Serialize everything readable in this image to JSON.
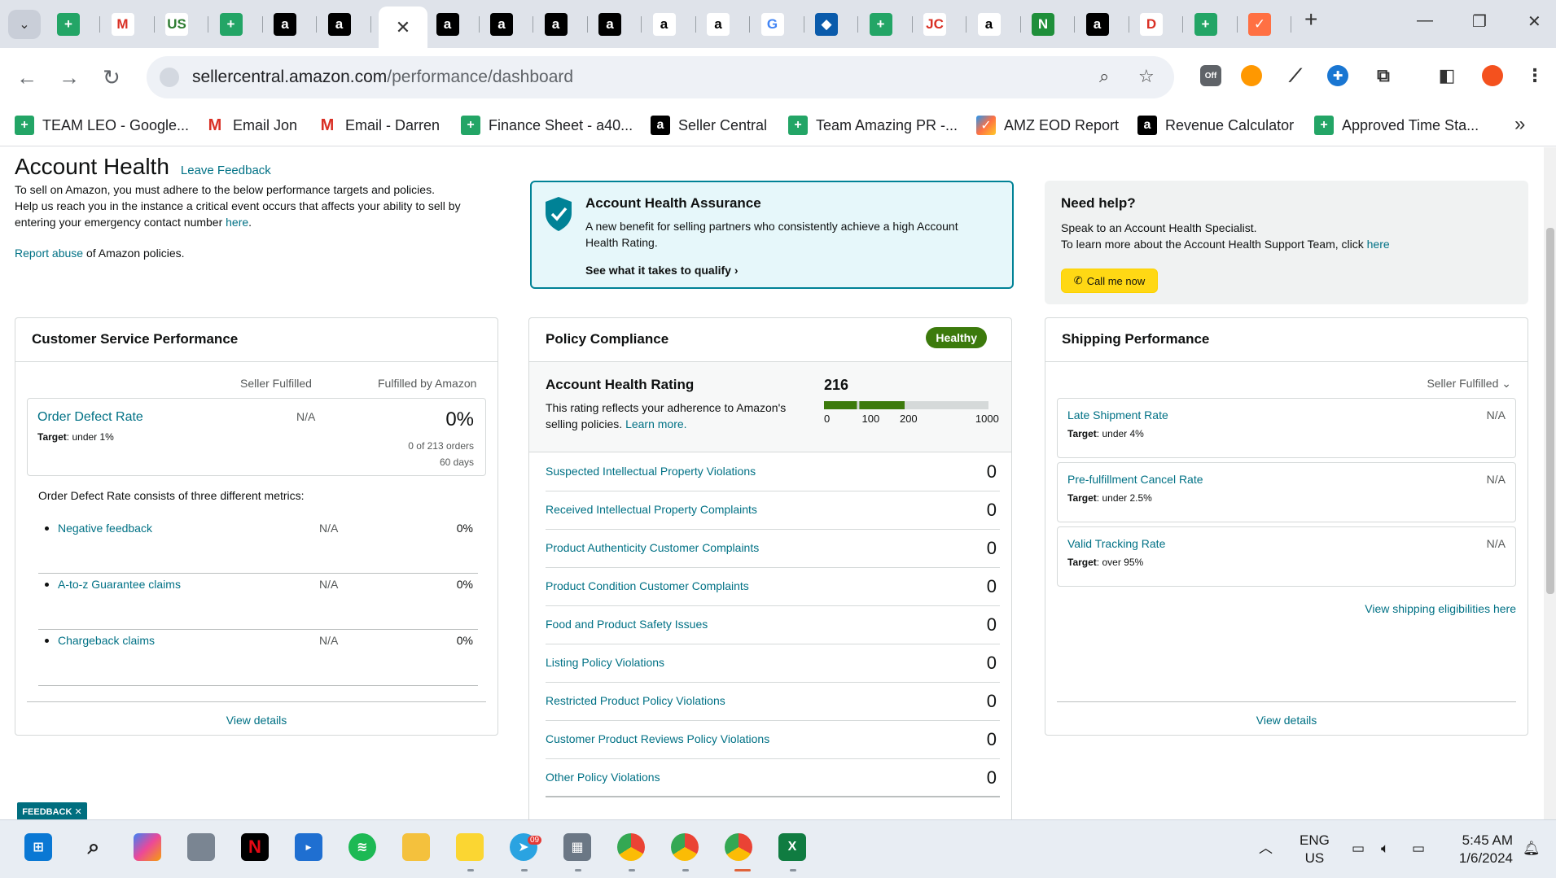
{
  "browser": {
    "url_host": "sellercentral.amazon.com",
    "url_path": "/performance/dashboard",
    "tab_close_glyph": "✕",
    "new_tab_glyph": "+",
    "extension_off_badge": "Off"
  },
  "bookmarks": [
    {
      "label": "TEAM LEO - Google...",
      "icon": "sheets-icon"
    },
    {
      "label": "Email Jon",
      "icon": "gmail-icon"
    },
    {
      "label": "Email - Darren",
      "icon": "gmail-icon"
    },
    {
      "label": "Finance Sheet - a40...",
      "icon": "sheets-icon"
    },
    {
      "label": "Seller Central",
      "icon": "amazon-icon"
    },
    {
      "label": "Team Amazing PR -...",
      "icon": "sheets-icon"
    },
    {
      "label": "AMZ EOD Report",
      "icon": "tasks-icon"
    },
    {
      "label": "Revenue Calculator",
      "icon": "amazon-icon"
    },
    {
      "label": "Approved Time Sta...",
      "icon": "sheets-icon"
    }
  ],
  "header": {
    "title": "Account Health",
    "leave_feedback": "Leave Feedback",
    "intro_1": "To sell on Amazon, you must adhere to the below performance targets and policies.",
    "intro_2": "Help us reach you in the instance a critical event occurs that affects your ability to sell by entering your emergency contact number ",
    "intro_link": "here",
    "intro_end": ".",
    "report_link": "Report abuse",
    "report_rest": " of Amazon policies."
  },
  "assurance": {
    "title": "Account Health Assurance",
    "desc": "A new benefit for selling partners who consistently achieve a high Account Health Rating.",
    "link": "See what it takes to qualify",
    "accent": "#008296"
  },
  "help": {
    "title": "Need help?",
    "line1": "Speak to an Account Health Specialist.",
    "line2": "To learn more about the Account Health Support Team, click ",
    "line2_link": "here",
    "call_button": "Call me now"
  },
  "customer_service": {
    "title": "Customer Service Performance",
    "col_seller": "Seller Fulfilled",
    "col_amazon": "Fulfilled by Amazon",
    "odr_name": "Order Defect Rate",
    "odr_target_label": "Target",
    "odr_target": ": under 1%",
    "odr_seller": "N/A",
    "odr_amazon": "0%",
    "odr_orders": "0 of 213 orders",
    "odr_period": "60 days",
    "note": "Order Defect Rate consists of three different metrics:",
    "metrics": [
      {
        "name": "Negative feedback",
        "seller": "N/A",
        "amazon": "0%"
      },
      {
        "name": "A-to-z Guarantee claims",
        "seller": "N/A",
        "amazon": "0%"
      },
      {
        "name": "Chargeback claims",
        "seller": "N/A",
        "amazon": "0%"
      }
    ],
    "view_details": "View details"
  },
  "policy": {
    "title": "Policy Compliance",
    "badge": "Healthy",
    "rating_title": "Account Health Rating",
    "rating_desc": "This rating reflects your adherence to Amazon's selling policies. ",
    "rating_link": "Learn more.",
    "score": "216",
    "score_fraction": 0.216,
    "ticks": [
      "0",
      "100",
      "200",
      "1000"
    ],
    "rows": [
      {
        "name": "Suspected Intellectual Property Violations",
        "value": "0"
      },
      {
        "name": "Received Intellectual Property Complaints",
        "value": "0"
      },
      {
        "name": "Product Authenticity Customer Complaints",
        "value": "0"
      },
      {
        "name": "Product Condition Customer Complaints",
        "value": "0"
      },
      {
        "name": "Food and Product Safety Issues",
        "value": "0"
      },
      {
        "name": "Listing Policy Violations",
        "value": "0"
      },
      {
        "name": "Restricted Product Policy Violations",
        "value": "0"
      },
      {
        "name": "Customer Product Reviews Policy Violations",
        "value": "0"
      },
      {
        "name": "Other Policy Violations",
        "value": "0"
      }
    ]
  },
  "shipping": {
    "title": "Shipping Performance",
    "filter": "Seller Fulfilled",
    "metrics": [
      {
        "name": "Late Shipment Rate",
        "target_label": "Target",
        "target": ": under 4%",
        "value": "N/A"
      },
      {
        "name": "Pre-fulfillment Cancel Rate",
        "target_label": "Target",
        "target": ": under 2.5%",
        "value": "N/A"
      },
      {
        "name": "Valid Tracking Rate",
        "target_label": "Target",
        "target": ": over 95%",
        "value": "N/A"
      }
    ],
    "eligibility_link": "View shipping eligibilities here",
    "view_details": "View details"
  },
  "feedback_tab": "FEEDBACK ✕",
  "taskbar": {
    "lang": "ENG",
    "region": "US",
    "time": "5:45 AM",
    "date": "1/6/2024",
    "telegram_badge": "09"
  }
}
